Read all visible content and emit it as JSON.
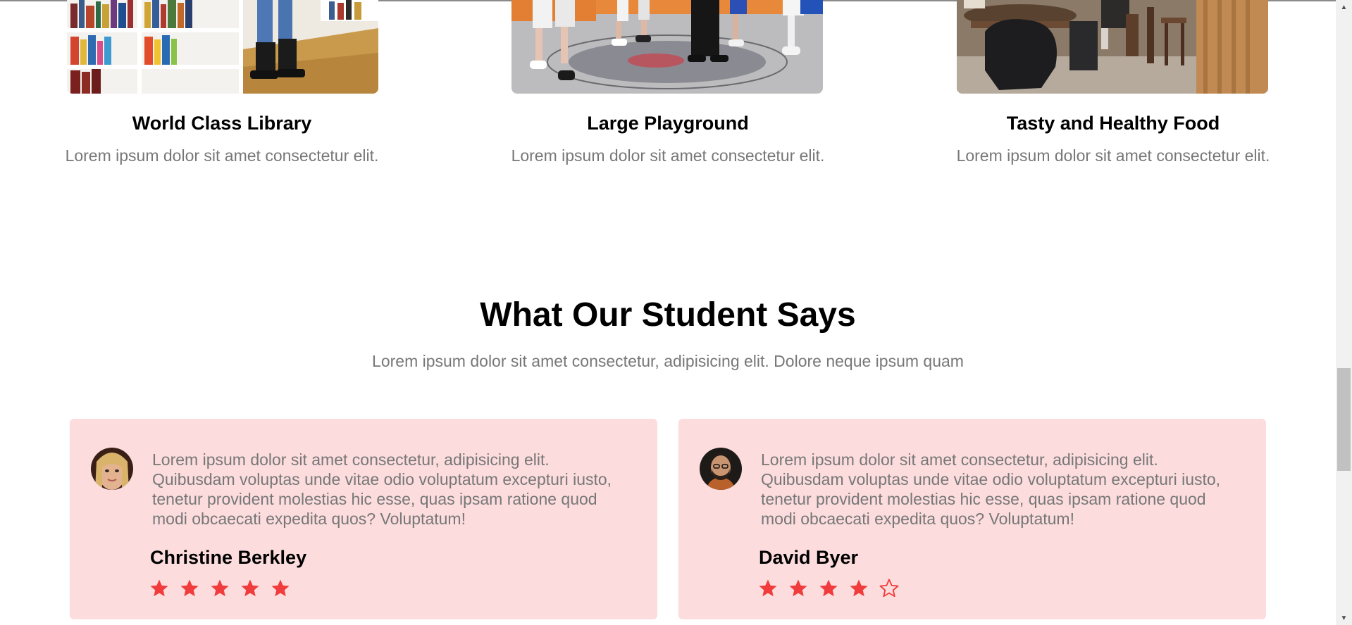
{
  "facilities": [
    {
      "title": "World Class Library",
      "text": "Lorem ipsum dolor sit amet consectetur elit."
    },
    {
      "title": "Large Playground",
      "text": "Lorem ipsum dolor sit amet consectetur elit."
    },
    {
      "title": "Tasty and Healthy Food",
      "text": "Lorem ipsum dolor sit amet consectetur elit."
    }
  ],
  "testimonials": {
    "title": "What Our Student Says",
    "subtitle": "Lorem ipsum dolor sit amet consectetur, adipisicing elit. Dolore neque ipsum quam",
    "items": [
      {
        "quote": "Lorem ipsum dolor sit amet consectetur, adipisicing elit. Quibusdam voluptas unde vitae odio voluptatum excepturi iusto, tenetur provident molestias hic esse, quas ipsam ratione quod modi obcaecati expedita quos? Voluptatum!",
        "name": "Christine Berkley",
        "rating": 5,
        "max_rating": 5
      },
      {
        "quote": "Lorem ipsum dolor sit amet consectetur, adipisicing elit. Quibusdam voluptas unde vitae odio voluptatum excepturi iusto, tenetur provident molestias hic esse, quas ipsam ratione quod modi obcaecati expedita quos? Voluptatum!",
        "name": "David Byer",
        "rating": 4,
        "max_rating": 5
      }
    ]
  },
  "colors": {
    "card_background": "#fcdcdd",
    "star": "#f03c3c",
    "muted_text": "#777777"
  },
  "icons": {
    "star_filled": "star-filled-icon",
    "star_empty": "star-outline-icon",
    "scroll_up": "scroll-up-arrow-icon",
    "scroll_down": "scroll-down-arrow-icon"
  }
}
